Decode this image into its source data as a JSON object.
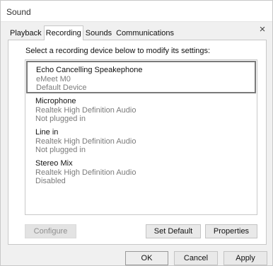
{
  "window": {
    "title": "Sound"
  },
  "tabs": [
    {
      "label": "Playback"
    },
    {
      "label": "Recording"
    },
    {
      "label": "Sounds"
    },
    {
      "label": "Communications"
    }
  ],
  "panel": {
    "instruction": "Select a recording device below to modify its settings:"
  },
  "devices": [
    {
      "name": "Echo Cancelling Speakephone",
      "driver": "eMeet M0",
      "status": "Default Device",
      "selected": true
    },
    {
      "name": "Microphone",
      "driver": "Realtek High Definition Audio",
      "status": "Not plugged in",
      "selected": false
    },
    {
      "name": "Line in",
      "driver": "Realtek High Definition Audio",
      "status": "Not plugged in",
      "selected": false
    },
    {
      "name": "Stereo Mix",
      "driver": "Realtek High Definition Audio",
      "status": "Disabled",
      "selected": false
    }
  ],
  "panel_buttons": {
    "configure": "Configure",
    "set_default": "Set Default",
    "properties": "Properties"
  },
  "dialog_buttons": {
    "ok": "OK",
    "cancel": "Cancel",
    "apply": "Apply"
  },
  "icons": {
    "close": "×"
  }
}
